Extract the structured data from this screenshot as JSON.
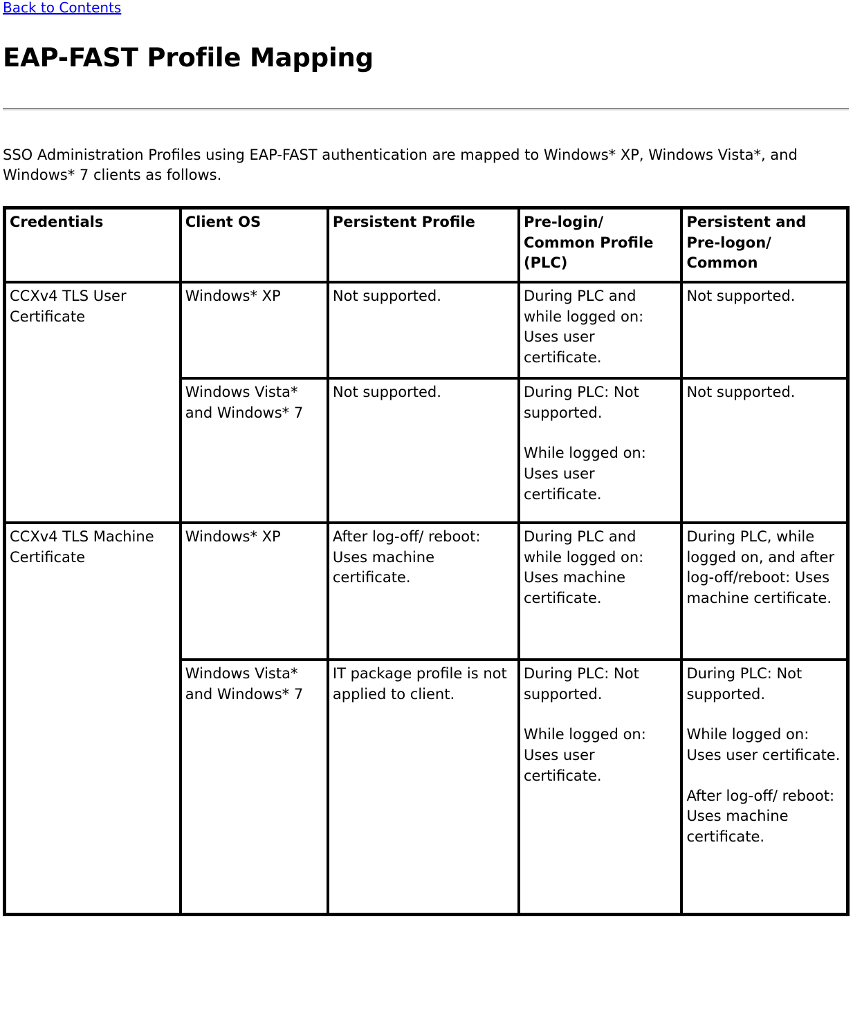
{
  "nav": {
    "back_link": "Back to Contents"
  },
  "header": {
    "title": "EAP-FAST Profile Mapping"
  },
  "intro": {
    "paragraph": "SSO Administration Profiles using EAP-FAST authentication are mapped to Windows* XP, Windows Vista*, and Windows* 7 clients as follows."
  },
  "colors": {
    "link": "#0000ee",
    "text": "#000000",
    "background": "#ffffff",
    "table_border": "#000000",
    "divider": "#8c8c8c"
  },
  "table": {
    "columns": [
      "Credentials",
      "Client OS",
      "Persistent Profile",
      "Pre-login/ Common Profile (PLC)",
      "Persistent and Pre-logon/ Common"
    ],
    "rows": [
      {
        "credentials": "CCXv4 TLS User Certificate",
        "client_os": "Windows* XP",
        "persistent_profile": "Not supported.",
        "plc_1": "During PLC and while logged on: Uses user certificate.",
        "plc_2": "",
        "plc_3": "",
        "prelogon_1": "Not supported.",
        "prelogon_2": "",
        "prelogon_3": ""
      },
      {
        "credentials": "",
        "client_os": "Windows Vista* and Windows* 7",
        "persistent_profile": "Not supported.",
        "plc_1": "During PLC: Not supported.",
        "plc_2": "While logged on: Uses user certificate.",
        "plc_3": "",
        "prelogon_1": "Not supported.",
        "prelogon_2": "",
        "prelogon_3": ""
      },
      {
        "credentials": "CCXv4 TLS Machine Certificate",
        "client_os": "Windows* XP",
        "persistent_profile": "After log-off/ reboot: Uses machine certificate.",
        "plc_1": "During PLC and while logged on: Uses machine certificate.",
        "plc_2": "",
        "plc_3": "",
        "prelogon_1": "During PLC, while logged on, and after log-off/reboot: Uses machine certificate.",
        "prelogon_2": "",
        "prelogon_3": ""
      },
      {
        "credentials": "",
        "client_os": "Windows Vista* and Windows* 7",
        "persistent_profile": "IT package profile is not applied to client.",
        "plc_1": "During PLC: Not supported.",
        "plc_2": "While logged on: Uses user certificate.",
        "plc_3": "",
        "prelogon_1": "During PLC: Not supported.",
        "prelogon_2": "While logged on: Uses user certificate.",
        "prelogon_3": "After log-off/ reboot: Uses machine certificate."
      }
    ]
  }
}
